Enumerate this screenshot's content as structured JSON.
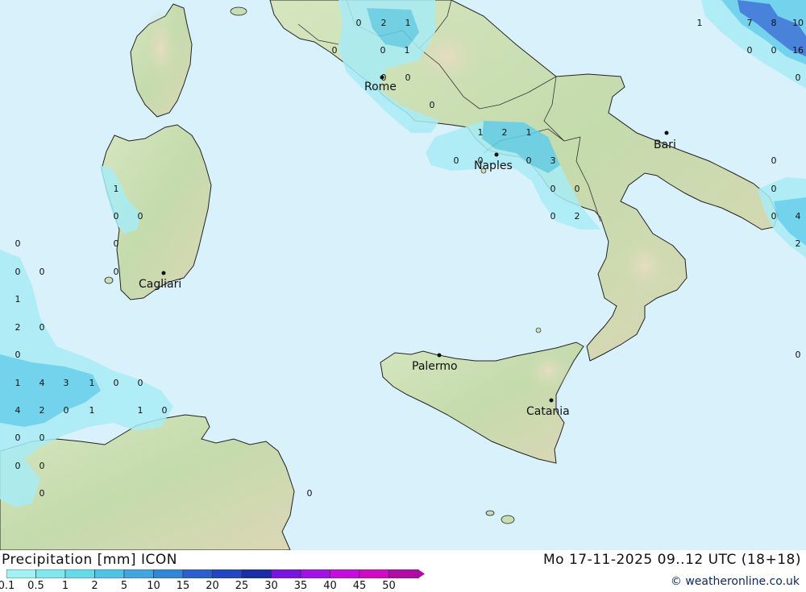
{
  "footer": {
    "title": "Precipitation [mm] ICON",
    "date": "Mo 17-11-2025 09..12 UTC (18+18)",
    "credit": "© weatheronline.co.uk"
  },
  "legend": {
    "ticks": [
      "0.1",
      "0.5",
      "1",
      "2",
      "5",
      "10",
      "15",
      "20",
      "25",
      "30",
      "35",
      "40",
      "45",
      "50"
    ],
    "colors": [
      "#9ff3f3",
      "#7ee8ee",
      "#62dce8",
      "#4cc4e6",
      "#3ea6e0",
      "#2f87d8",
      "#2a5fd0",
      "#2346c4",
      "#1a2ca8",
      "#7a14e0",
      "#a410e8",
      "#c80ce0",
      "#d20ac8",
      "#b40aa8"
    ]
  },
  "colors": {
    "sea": "#d8f1fa",
    "land_low": "#c8ddb0",
    "land_high": "#e0d8b8",
    "rain_light": "#a8ecf6",
    "rain_mid": "#62cdea",
    "rain_heavy": "#2f6fd6"
  },
  "cities": [
    {
      "name": "Rome"
    },
    {
      "name": "Naples"
    },
    {
      "name": "Bari"
    },
    {
      "name": "Cagliari"
    },
    {
      "name": "Palermo"
    },
    {
      "name": "Catania"
    }
  ],
  "values": [
    "0",
    "2",
    "1",
    "0",
    "0",
    "1",
    "0",
    "0",
    "0",
    "1",
    "2",
    "1",
    "0",
    "0",
    "0",
    "3",
    "0",
    "0",
    "0",
    "2",
    "1",
    "7",
    "8",
    "10",
    "0",
    "0",
    "16",
    "0",
    "0",
    "0",
    "0",
    "4",
    "2",
    "0",
    "1",
    "0",
    "0",
    "0",
    "0",
    "0",
    "0",
    "1",
    "2",
    "0",
    "0",
    "1",
    "4",
    "3",
    "1",
    "0",
    "0",
    "4",
    "2",
    "0",
    "1",
    "1",
    "0",
    "0",
    "0",
    "0",
    "0",
    "0",
    "0",
    "0",
    "0"
  ]
}
